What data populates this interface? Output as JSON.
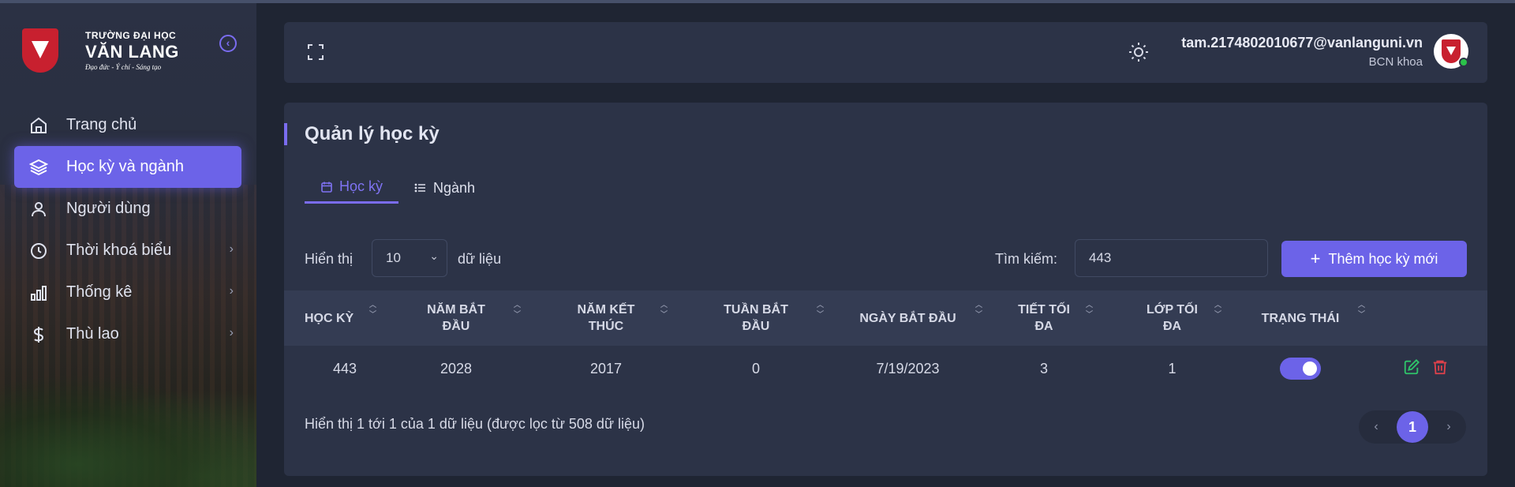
{
  "brand": {
    "line1": "TRƯỜNG ĐẠI HỌC",
    "line2": "VĂN LANG",
    "line3": "Đạo đức - Ý chí - Sáng tạo"
  },
  "sidebar": {
    "items": [
      {
        "label": "Trang chủ",
        "icon": "home-icon"
      },
      {
        "label": "Học kỳ và ngành",
        "icon": "layers-icon",
        "active": true
      },
      {
        "label": "Người dùng",
        "icon": "user-icon"
      },
      {
        "label": "Thời khoá biểu",
        "icon": "clock-icon",
        "has_submenu": true
      },
      {
        "label": "Thống kê",
        "icon": "bar-chart-icon",
        "has_submenu": true
      },
      {
        "label": "Thù lao",
        "icon": "dollar-icon",
        "has_submenu": true
      }
    ]
  },
  "header": {
    "email": "tam.2174802010677@vanlanguni.vn",
    "role": "BCN khoa"
  },
  "page": {
    "title": "Quản lý học kỳ",
    "tabs": [
      {
        "label": "Học kỳ",
        "icon": "calendar-icon",
        "active": true
      },
      {
        "label": "Ngành",
        "icon": "list-icon"
      }
    ]
  },
  "table_controls": {
    "show_label": "Hiển thị",
    "page_length": "10",
    "records_label": "dữ liệu",
    "search_label": "Tìm kiếm:",
    "search_value": "443",
    "add_button": "Thêm học kỳ mới"
  },
  "table": {
    "columns": [
      "HỌC KỲ",
      "NĂM BẮT ĐẦU",
      "NĂM KẾT THÚC",
      "TUẦN BẮT ĐẦU",
      "NGÀY BẮT ĐẦU",
      "TIẾT TỐI ĐA",
      "LỚP TỐI ĐA",
      "TRẠNG THÁI"
    ],
    "rows": [
      {
        "hoc_ky": "443",
        "nam_bat_dau": "2028",
        "nam_ket_thuc": "2017",
        "tuan_bat_dau": "0",
        "ngay_bat_dau": "7/19/2023",
        "tiet_toi_da": "3",
        "lop_toi_da": "1",
        "trang_thai": true
      }
    ]
  },
  "footer": {
    "info": "Hiển thị 1 tới 1 của 1 dữ liệu (được lọc từ 508 dữ liệu)",
    "current_page": "1"
  },
  "colors": {
    "accent": "#6c63e8",
    "background": "#1f2533",
    "card": "#2c3347",
    "edit": "#2fc46a",
    "delete": "#e0414b"
  }
}
